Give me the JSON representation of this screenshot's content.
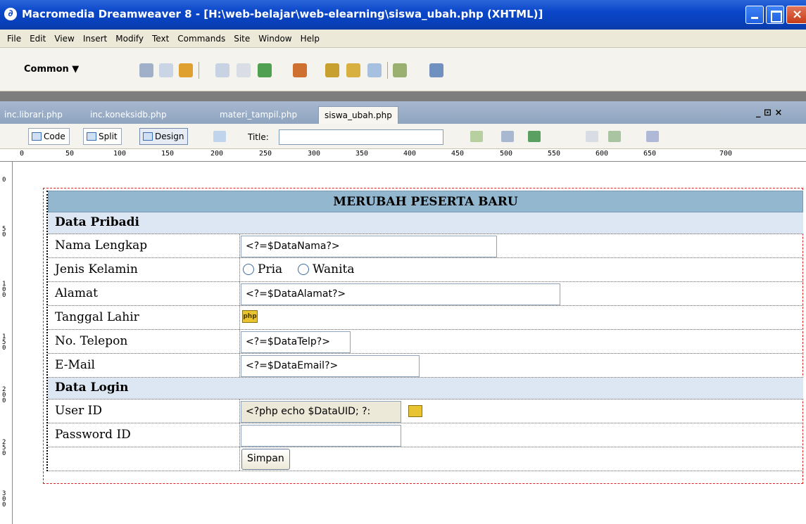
{
  "window": {
    "title": "Macromedia Dreamweaver 8 - [H:\\web-belajar\\web-elearning\\siswa_ubah.php (XHTML)]",
    "app_icon": "dreamweaver-icon"
  },
  "menubar": {
    "items": [
      "File",
      "Edit",
      "View",
      "Insert",
      "Modify",
      "Text",
      "Commands",
      "Site",
      "Window",
      "Help"
    ]
  },
  "insertbar": {
    "category": "Common ▼"
  },
  "doctabs": {
    "tabs": [
      "inc.librari.php",
      "inc.koneksidb.php",
      "materi_tampil.php",
      "siswa_ubah.php"
    ],
    "active": "siswa_ubah.php",
    "controls": "_ ⊡ ×"
  },
  "doctoolbar": {
    "code_label": "Code",
    "split_label": "Split",
    "design_label": "Design",
    "title_label": "Title:",
    "title_value": ""
  },
  "ruler": {
    "h_labels": [
      "0",
      "50",
      "100",
      "150",
      "200",
      "250",
      "300",
      "350",
      "400",
      "450",
      "500",
      "550",
      "600",
      "650",
      "700"
    ],
    "v_labels": [
      "0",
      "50",
      "100",
      "150",
      "200",
      "250",
      "300"
    ]
  },
  "form": {
    "heading": "MERUBAH PESERTA BARU",
    "section_personal": "Data Pribadi",
    "labels": {
      "nama": "Nama Lengkap",
      "kelamin": "Jenis Kelamin",
      "alamat": "Alamat",
      "tanggal": "Tanggal Lahir",
      "telepon": "No. Telepon",
      "email": "E-Mail",
      "userid": "User ID",
      "password": "Password ID"
    },
    "values": {
      "nama": "<?=$DataNama?>",
      "alamat": "<?=$DataAlamat?>",
      "telepon": "<?=$DataTelp?>",
      "email": "<?=$DataEmail?>",
      "userid": "<?php echo $DataUID; ?:",
      "password": ""
    },
    "gender_options": [
      "Pria",
      "Wanita"
    ],
    "section_login": "Data Login",
    "submit_label": "Simpan",
    "php_icon_text": "php"
  }
}
